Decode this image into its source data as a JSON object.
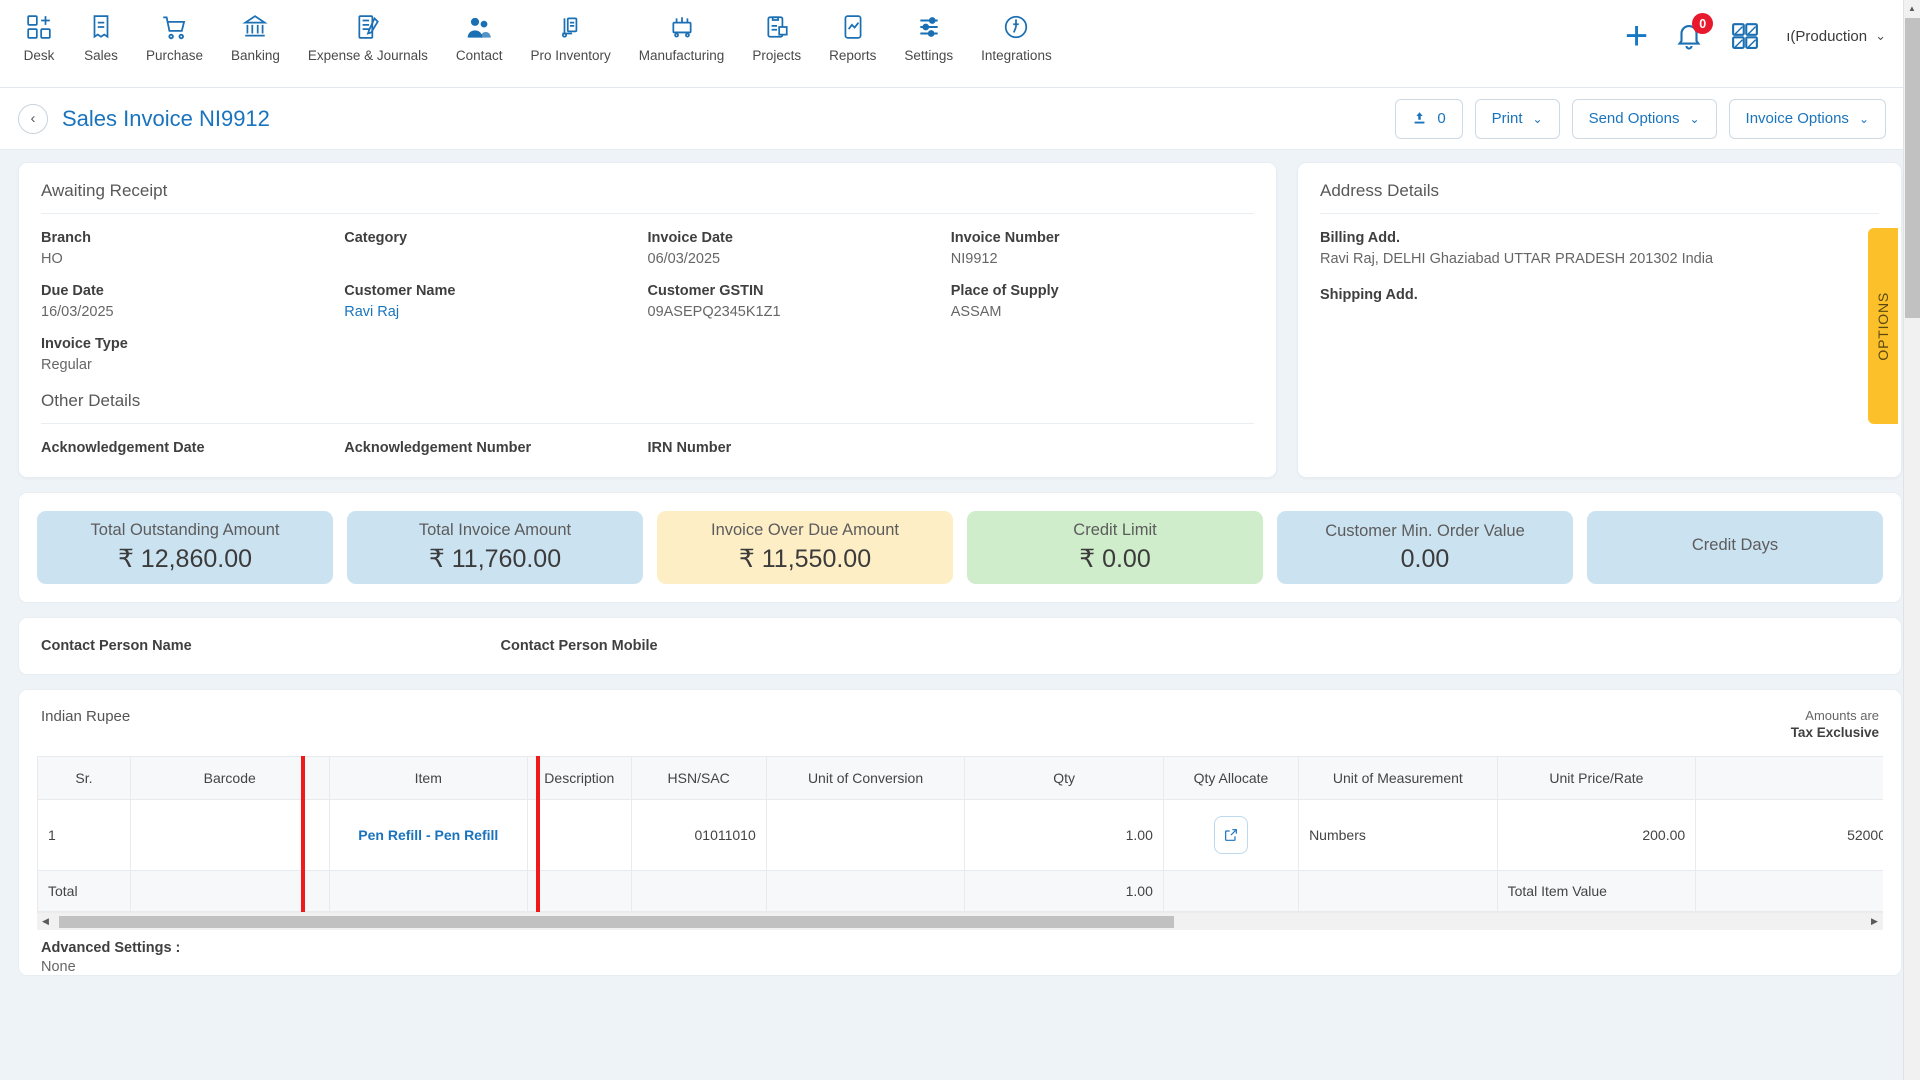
{
  "topnav": {
    "items": [
      {
        "label": "Desk",
        "icon": "desk-icon"
      },
      {
        "label": "Sales",
        "icon": "sales-receipt-icon"
      },
      {
        "label": "Purchase",
        "icon": "shopping-cart-icon"
      },
      {
        "label": "Banking",
        "icon": "bank-icon"
      },
      {
        "label": "Expense & Journals",
        "icon": "journal-icon"
      },
      {
        "label": "Contact",
        "icon": "people-icon"
      },
      {
        "label": "Pro Inventory",
        "icon": "inventory-icon"
      },
      {
        "label": "Manufacturing",
        "icon": "manufacturing-icon"
      },
      {
        "label": "Projects",
        "icon": "projects-clipboard-icon"
      },
      {
        "label": "Reports",
        "icon": "reports-chart-icon"
      },
      {
        "label": "Settings",
        "icon": "sliders-icon"
      },
      {
        "label": "Integrations",
        "icon": "plug-icon"
      }
    ],
    "add_label": "+",
    "notification_count": "0",
    "company": "ı(Production",
    "company_caret": "⌄"
  },
  "titlebar": {
    "back": "‹",
    "title": "Sales Invoice NI9912",
    "attachment_count": "0",
    "print_label": "Print",
    "send_options_label": "Send Options",
    "invoice_options_label": "Invoice Options",
    "chevron": "⌄"
  },
  "invoice_panel": {
    "status": "Awaiting Receipt",
    "fields": [
      {
        "label": "Branch",
        "value": "HO",
        "link": false
      },
      {
        "label": "Category",
        "value": "",
        "link": false
      },
      {
        "label": "Invoice Date",
        "value": "06/03/2025",
        "link": false
      },
      {
        "label": "Invoice Number",
        "value": "NI9912",
        "link": false
      },
      {
        "label": "Due Date",
        "value": "16/03/2025",
        "link": false
      },
      {
        "label": "Customer Name",
        "value": "Ravi Raj",
        "link": true
      },
      {
        "label": "Customer GSTIN",
        "value": "09ASEPQ2345K1Z1",
        "link": false
      },
      {
        "label": "Place of Supply",
        "value": "ASSAM",
        "link": false
      },
      {
        "label": "Invoice Type",
        "value": "Regular",
        "link": false
      }
    ],
    "other_details_title": "Other Details",
    "other_details": [
      {
        "label": "Acknowledgement Date",
        "value": ""
      },
      {
        "label": "Acknowledgement Number",
        "value": ""
      },
      {
        "label": "IRN Number",
        "value": ""
      }
    ]
  },
  "address_panel": {
    "title": "Address Details",
    "billing_label": "Billing Add.",
    "billing_value": "Ravi Raj, DELHI Ghaziabad UTTAR PRADESH 201302 India",
    "shipping_label": "Shipping Add.",
    "shipping_value": ""
  },
  "kpis": [
    {
      "label": "Total Outstanding Amount",
      "value": "₹ 12,860.00",
      "color": "#cbe2f1"
    },
    {
      "label": "Total Invoice Amount",
      "value": "₹ 11,760.00",
      "color": "#cbe2f1"
    },
    {
      "label": "Invoice Over Due Amount",
      "value": "₹ 11,550.00",
      "color": "#fdeec6"
    },
    {
      "label": "Credit Limit",
      "value": "₹ 0.00",
      "color": "#cfeccb"
    },
    {
      "label": "Customer Min. Order Value",
      "value": "0.00",
      "color": "#cbe2f1"
    },
    {
      "label": "Credit Days",
      "value": "",
      "color": "#cbe2f1"
    }
  ],
  "contact": {
    "name_label": "Contact Person Name",
    "name_value": "",
    "mobile_label": "Contact Person Mobile",
    "mobile_value": ""
  },
  "items_section": {
    "currency": "Indian Rupee",
    "tax_note_line1": "Amounts are",
    "tax_note_line2": "Tax Exclusive",
    "columns": [
      "Sr.",
      "Barcode",
      "Item",
      "Description",
      "HSN/SAC",
      "Unit of Conversion",
      "Qty",
      "Qty Allocate",
      "Unit of Measurement",
      "Unit Price/Rate",
      ""
    ],
    "rows": [
      {
        "sr": "1",
        "barcode": "",
        "item": "Pen Refill - Pen Refill",
        "description": "",
        "hsn_sac": "01011010",
        "unit_of_conversion": "",
        "qty": "1.00",
        "qty_allocate_icon": "external-link-icon",
        "unit_of_measurement": "Numbers",
        "unit_price": "200.00",
        "extra": "52000"
      }
    ],
    "total_row": {
      "label": "Total",
      "qty": "1.00",
      "total_item_value_label": "Total Item Value"
    },
    "scroll_left_arrow": "◀",
    "scroll_right_arrow": "▶"
  },
  "advanced": {
    "label": "Advanced Settings :",
    "value": "None"
  },
  "options_tab": {
    "label": "OPTIONS"
  },
  "colors": {
    "accent_blue": "#1a74bd",
    "highlight_red": "#ef1b1b",
    "options_yellow": "#fcc02a",
    "badge_red": "#e8192c"
  }
}
